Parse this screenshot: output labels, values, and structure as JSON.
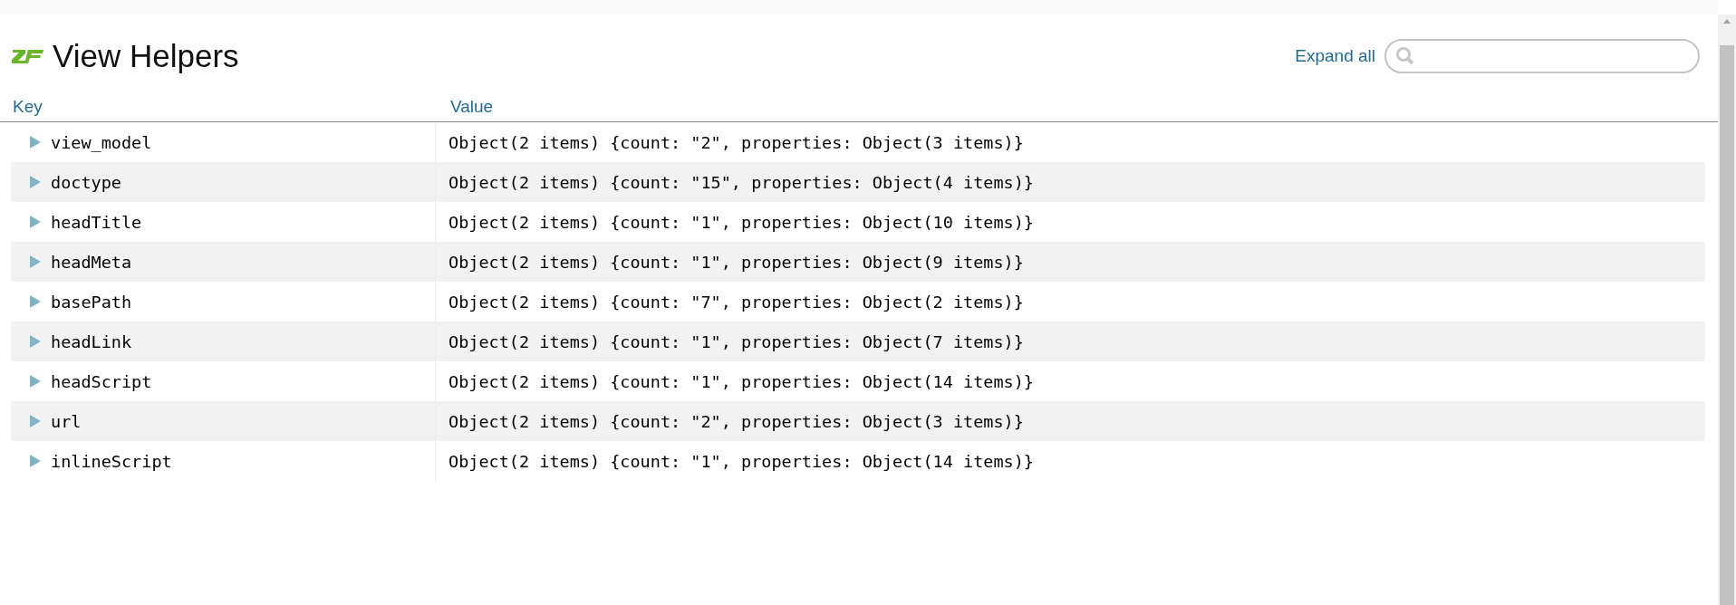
{
  "title": "View Helpers",
  "expand_all": "Expand all",
  "columns": [
    "Key",
    "Value"
  ],
  "rows": [
    {
      "key": "view_model",
      "value": "Object(2 items) {count: \"2\", properties: Object(3 items)}",
      "expanded": false
    },
    {
      "key": "doctype",
      "value": "Object(2 items) {count: \"15\", properties: Object(4 items)}",
      "expanded": false
    },
    {
      "key": "headTitle",
      "value": "Object(2 items) {count: \"1\", properties: Object(10 items)}",
      "expanded": false
    },
    {
      "key": "headMeta",
      "value": "Object(2 items) {count: \"1\", properties: Object(9 items)}",
      "expanded": false
    },
    {
      "key": "basePath",
      "value": "Object(2 items) {count: \"7\", properties: Object(2 items)}",
      "expanded": false
    },
    {
      "key": "headLink",
      "value": "Object(2 items) {count: \"1\", properties: Object(7 items)}",
      "expanded": false
    },
    {
      "key": "headScript",
      "value": "Object(2 items) {count: \"1\", properties: Object(14 items)}",
      "expanded": false
    },
    {
      "key": "url",
      "value": "Object(2 items) {count: \"2\", properties: Object(3 items)}",
      "expanded": false
    },
    {
      "key": "inlineScript",
      "value": "Object(2 items) {count: \"1\", properties: Object(14 items)}",
      "expanded": false
    }
  ]
}
